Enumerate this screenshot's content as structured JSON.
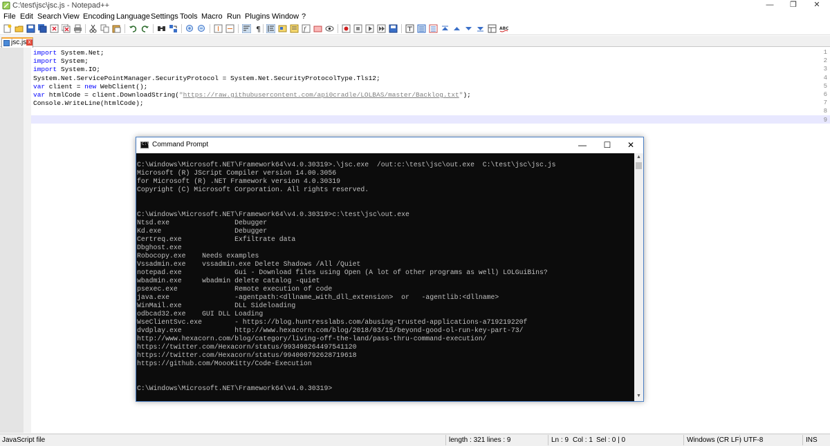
{
  "window": {
    "title": "C:\\test\\jsc\\jsc.js - Notepad++",
    "minimize": "—",
    "maximize": "❐",
    "close": "✕"
  },
  "menu": [
    "File",
    "Edit",
    "Search",
    "View",
    "Encoding",
    "Language",
    "Settings",
    "Tools",
    "Macro",
    "Run",
    "Plugins",
    "Window",
    "?"
  ],
  "toolbar_icons": [
    "new-file-icon",
    "open-file-icon",
    "save-icon",
    "save-all-icon",
    "close-icon",
    "close-all-icon",
    "print-icon",
    "cut-icon",
    "copy-icon",
    "paste-icon",
    "undo-icon",
    "redo-icon",
    "find-icon",
    "replace-icon",
    "zoom-in-icon",
    "zoom-out-icon",
    "sync-vertical-icon",
    "sync-horizontal-icon",
    "word-wrap-icon",
    "show-all-chars-icon",
    "indent-guide-icon",
    "user-language-icon",
    "doc-map-icon",
    "function-list-icon",
    "folder-workspace-icon",
    "monitoring-icon",
    "record-macro-icon",
    "stop-record-icon",
    "play-macro-icon",
    "run-macro-multiple-icon",
    "save-macro-icon",
    "plugin-a-icon",
    "plugin-b-icon",
    "plugin-c-icon",
    "plugin-d-icon",
    "plugin-e-icon",
    "plugin-f-icon",
    "spellcheck-icon"
  ],
  "tab": {
    "label": "jsc.js",
    "close": "x"
  },
  "editor": {
    "line_numbers": [
      "1",
      "2",
      "3",
      "4",
      "5",
      "6",
      "7",
      "8",
      "9"
    ],
    "lines": [
      [
        {
          "t": "import",
          "c": "kw"
        },
        {
          "t": " System.Net;",
          "c": ""
        }
      ],
      [
        {
          "t": "import",
          "c": "kw"
        },
        {
          "t": " System;",
          "c": ""
        }
      ],
      [
        {
          "t": "import",
          "c": "kw"
        },
        {
          "t": " System.IO;",
          "c": ""
        }
      ],
      [
        {
          "t": "System.Net.ServicePointManager.SecurityProtocol = System.Net.SecurityProtocolType.Tls12;",
          "c": ""
        }
      ],
      [
        {
          "t": "var",
          "c": "kw"
        },
        {
          "t": " client = ",
          "c": ""
        },
        {
          "t": "new",
          "c": "kw"
        },
        {
          "t": " WebClient();",
          "c": ""
        }
      ],
      [
        {
          "t": "var",
          "c": "kw"
        },
        {
          "t": " htmlCode = client.DownloadString(",
          "c": ""
        },
        {
          "t": "\"",
          "c": "str"
        },
        {
          "t": "https://raw.githubusercontent.com/api0cradle/LOLBAS/master/Backlog.txt",
          "c": "url"
        },
        {
          "t": "\"",
          "c": "str"
        },
        {
          "t": ");",
          "c": ""
        }
      ],
      [
        {
          "t": "Console.WriteLine(htmlCode);",
          "c": ""
        }
      ],
      [],
      []
    ]
  },
  "cmd": {
    "title": "Command Prompt",
    "icon_text": "C:\\",
    "minimize": "—",
    "maximize": "☐",
    "close": "✕",
    "lines": [
      "C:\\Windows\\Microsoft.NET\\Framework64\\v4.0.30319>.\\jsc.exe  /out:c:\\test\\jsc\\out.exe  C:\\test\\jsc\\jsc.js",
      "Microsoft (R) JScript Compiler version 14.00.3056",
      "for Microsoft (R) .NET Framework version 4.0.30319",
      "Copyright (C) Microsoft Corporation. All rights reserved.",
      "",
      "",
      "C:\\Windows\\Microsoft.NET\\Framework64\\v4.0.30319>c:\\test\\jsc\\out.exe",
      "Ntsd.exe                Debugger",
      "Kd.exe                  Debugger",
      "Certreq.exe             Exfiltrate data",
      "Dbghost.exe",
      "Robocopy.exe    Needs examples",
      "Vssadmin.exe    vssadmin.exe Delete Shadows /All /Quiet",
      "notepad.exe             Gui - Download files using Open (A lot of other programs as well) LOLGuiBins?",
      "wbadmin.exe     wbadmin delete catalog -quiet",
      "psexec.exe              Remote execution of code",
      "java.exe                -agentpath:<dllname_with_dll_extension>  or   -agentlib:<dllname>",
      "WinMail.exe             DLL Sideloading",
      "odbcad32.exe    GUI DLL Loading",
      "WseClientSvc.exe        - https://blog.huntresslabs.com/abusing-trusted-applications-a719219220f",
      "dvdplay.exe             http://www.hexacorn.com/blog/2018/03/15/beyond-good-ol-run-key-part-73/",
      "http://www.hexacorn.com/blog/category/living-off-the-land/pass-thru-command-execution/",
      "https://twitter.com/Hexacorn/status/993498264497541120",
      "https://twitter.com/Hexacorn/status/994000792628719618",
      "https://github.com/MoooKitty/Code-Execution",
      "",
      "",
      "C:\\Windows\\Microsoft.NET\\Framework64\\v4.0.30319>"
    ]
  },
  "status": {
    "file_type": "JavaScript file",
    "length": "length : 321",
    "lines": "lines : 9",
    "ln": "Ln : 9",
    "col": "Col : 1",
    "sel": "Sel : 0 | 0",
    "eol": "Windows (CR LF)",
    "encoding": "UTF-8",
    "mode": "INS"
  }
}
